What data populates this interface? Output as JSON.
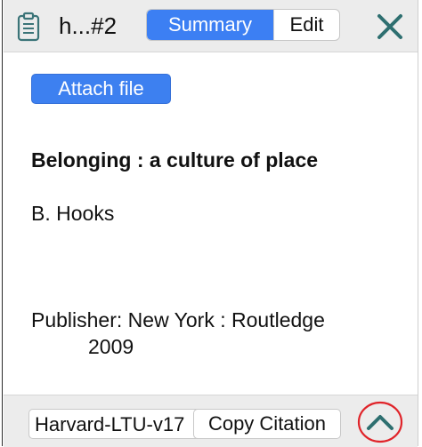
{
  "header": {
    "title": "h...#2",
    "tabs": [
      {
        "label": "Summary",
        "selected": true
      },
      {
        "label": "Edit",
        "selected": false
      }
    ],
    "close_icon": "close-icon",
    "doc_icon": "clipboard-icon"
  },
  "content": {
    "attach_label": "Attach file",
    "title": "Belonging : a culture of place",
    "author": "B. Hooks",
    "publisher": "Publisher: New York : Routledge",
    "year": "2009"
  },
  "footer": {
    "citation_style": "Harvard-LTU-v17",
    "copy_label": "Copy Citation",
    "collapse_icon": "chevron-up-icon"
  },
  "colors": {
    "accent": "#3c7ff3",
    "close": "#2e6f70",
    "highlight_ring": "#e0242a"
  }
}
